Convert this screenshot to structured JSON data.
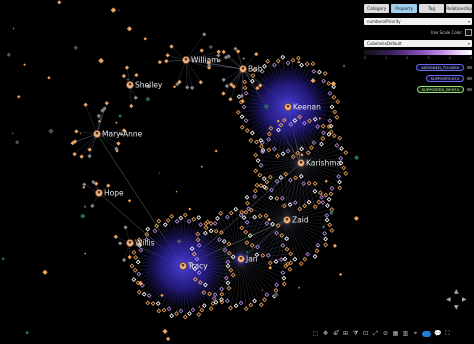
{
  "colors": {
    "background": "#000000",
    "node": "#f0a35a",
    "node_dark": "#3b2a1a",
    "edge": "#9fa8d8",
    "hub_glow": "#3a2fb8",
    "green_edge": "#7fd07a"
  },
  "tabs": [
    {
      "label": "Category",
      "active": false
    },
    {
      "label": "Property",
      "active": true
    },
    {
      "label": "Tag",
      "active": false
    },
    {
      "label": "Relationship",
      "active": false
    }
  ],
  "property_select": {
    "value": "numberofPriority"
  },
  "toggle": {
    "label": "Use Scale Color"
  },
  "palette_select": {
    "value": "CubehelixDefault"
  },
  "colorbar_ticks": [
    "0",
    "1",
    "2",
    "3",
    "4",
    "5"
  ],
  "relationships": [
    {
      "label": "ASSIGNED_TO:0000",
      "style": "blue"
    },
    {
      "label": "SUPPORTS:974",
      "style": "blue"
    },
    {
      "label": "SUPPORTED_BY:974",
      "style": "green"
    }
  ],
  "people": [
    {
      "name": "William"
    },
    {
      "name": "Bob"
    },
    {
      "name": "Shelley"
    },
    {
      "name": "Keenan"
    },
    {
      "name": "Mary-Anne"
    },
    {
      "name": "Karishma"
    },
    {
      "name": "Hope"
    },
    {
      "name": "Zaid"
    },
    {
      "name": "Willis"
    },
    {
      "name": "Jan"
    },
    {
      "name": "Tracy"
    }
  ],
  "toolbar_icons": [
    "select-icon",
    "move-icon",
    "zoom-icon",
    "layout-icon",
    "filter-icon",
    "group-icon",
    "expand-icon",
    "hide-icon",
    "grid-icon",
    "chart-icon",
    "pin-icon",
    "toggle-icon",
    "comment-icon",
    "fullscreen-icon"
  ],
  "nav_icons": {
    "up": "▲",
    "down": "▼",
    "left": "◀",
    "right": "▶"
  }
}
